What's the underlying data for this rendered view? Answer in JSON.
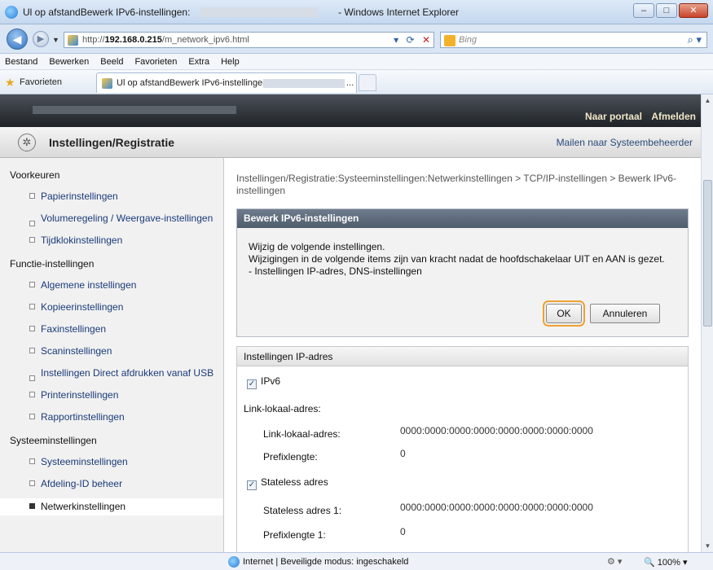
{
  "window": {
    "title": "Ul op afstandBewerk IPv6-instellingen:",
    "title_suffix": "- Windows Internet Explorer",
    "buttons": {
      "minimize": "–",
      "maximize": "□",
      "close": "✕"
    }
  },
  "address": {
    "url_prefix": "http://",
    "url_host": "192.168.0.215",
    "url_path": "/m_network_ipv6.html",
    "search_placeholder": "Bing"
  },
  "menu": [
    "Bestand",
    "Bewerken",
    "Beeld",
    "Favorieten",
    "Extra",
    "Help"
  ],
  "favorites_label": "Favorieten",
  "tab_label": "Ul op afstandBewerk IPv6-instellingen:",
  "tab_suffix": "...",
  "portal": {
    "naar_portaal": "Naar portaal",
    "afmelden": "Afmelden"
  },
  "header": {
    "title": "Instellingen/Registratie",
    "mail": "Mailen naar Systeembeheerder"
  },
  "sidebar": {
    "group1": "Voorkeuren",
    "group1_items": [
      "Papierinstellingen",
      "Volumeregeling / Weergave-instellingen",
      "Tijdklokinstellingen"
    ],
    "group2": "Functie-instellingen",
    "group2_items": [
      "Algemene instellingen",
      "Kopieerinstellingen",
      "Faxinstellingen",
      "Scaninstellingen",
      "Instellingen Direct afdrukken vanaf USB",
      "Printerinstellingen",
      "Rapportinstellingen"
    ],
    "group3": "Systeeminstellingen",
    "group3_items": [
      "Systeeminstellingen",
      "Afdeling-ID beheer",
      "Netwerkinstellingen"
    ]
  },
  "breadcrumb": "Instellingen/Registratie:Systeeminstellingen:Netwerkinstellingen > TCP/IP-instellingen > Bewerk IPv6-instellingen",
  "dialog": {
    "title": "Bewerk IPv6-instellingen",
    "line1": "Wijzig de volgende instellingen.",
    "line2": "Wijzigingen in de volgende items zijn van kracht nadat de hoofdschakelaar UIT en AAN is gezet.",
    "line3": "- Instellingen IP-adres, DNS-instellingen",
    "ok": "OK",
    "cancel": "Annuleren"
  },
  "section": {
    "title": "Instellingen IP-adres",
    "ipv6": "IPv6",
    "link_local_heading": "Link-lokaal-adres:",
    "link_local_label": "Link-lokaal-adres:",
    "link_local_value": "0000:0000:0000:0000:0000:0000:0000:0000",
    "prefix_label": "Prefixlengte:",
    "prefix_value": "0",
    "stateless": "Stateless adres",
    "stateless1_label": "Stateless adres 1:",
    "stateless1_value": "0000:0000:0000:0000:0000:0000:0000:0000",
    "prefix1_label": "Prefixlengte 1:",
    "prefix1_value": "0"
  },
  "status": {
    "text": "Internet | Beveiligde modus: ingeschakeld",
    "zoom": "100%"
  }
}
